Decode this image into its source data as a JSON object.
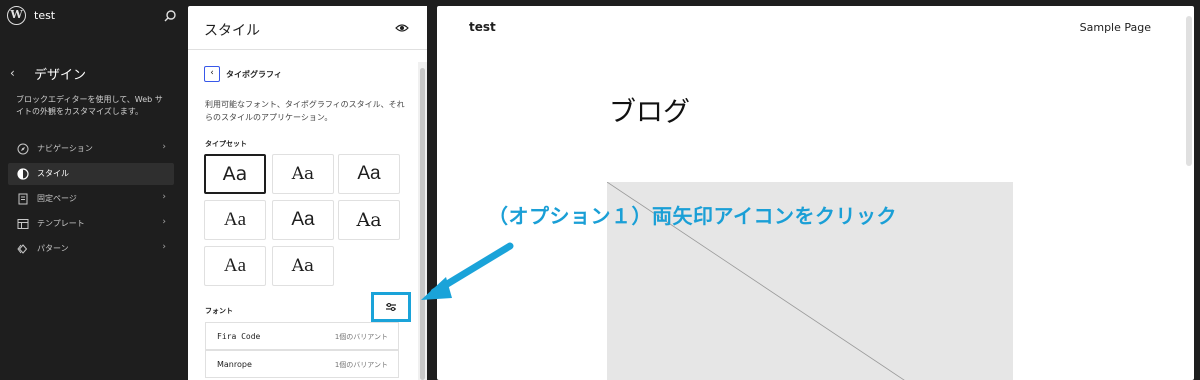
{
  "topbar": {
    "site_name": "test",
    "logo_glyph": "W"
  },
  "sidebar": {
    "back_glyph": "‹",
    "title": "デザイン",
    "description": "ブロックエディターを使用して、Web サイトの外観をカスタマイズします。",
    "items": [
      {
        "label": "ナビゲーション",
        "icon": "compass-icon",
        "active": false,
        "chevron": "›"
      },
      {
        "label": "スタイル",
        "icon": "half-circle-icon",
        "active": true,
        "chevron": ""
      },
      {
        "label": "固定ページ",
        "icon": "page-icon",
        "active": false,
        "chevron": "›"
      },
      {
        "label": "テンプレート",
        "icon": "layout-icon",
        "active": false,
        "chevron": "›"
      },
      {
        "label": "パターン",
        "icon": "diamond-icon",
        "active": false,
        "chevron": "›"
      }
    ]
  },
  "styles_panel": {
    "title": "スタイル",
    "typography": {
      "back_glyph": "‹",
      "title": "タイポグラフィ",
      "description": "利用可能なフォント、タイポグラフィのスタイル、それらのスタイルのアプリケーション。",
      "typesets_label": "タイプセット",
      "typeset_sample": "Aa",
      "fonts_label": "フォント",
      "fonts": [
        {
          "name": "Fira Code",
          "variants": "1個のバリアント"
        },
        {
          "name": "Manrope",
          "variants": "1個のバリアント"
        }
      ]
    }
  },
  "preview": {
    "site_title": "test",
    "nav_link": "Sample Page",
    "heading": "ブログ"
  },
  "annotation": {
    "text": "（オプション１）両矢印アイコンをクリック",
    "color": "#1aa3d9"
  },
  "colors": {
    "accent": "#3858e9",
    "annotation": "#1aa3d9",
    "admin_bg": "#1e1e1e"
  }
}
